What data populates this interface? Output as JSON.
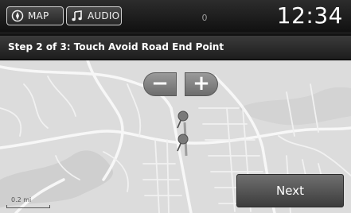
{
  "status_bar": {
    "map_tab": {
      "label": "MAP",
      "icon": "compass-icon"
    },
    "audio_tab": {
      "label": "AUDIO",
      "icon": "music-note-icon"
    },
    "signal_indicator": "0",
    "clock": "12:34"
  },
  "banner": {
    "instruction": "Step 2 of 3: Touch Avoid Road End Point"
  },
  "map": {
    "zoom_out_label": "−",
    "zoom_in_label": "+",
    "pins": [
      {
        "icon": "map-pin-icon",
        "color": "#6e6e6e"
      },
      {
        "icon": "map-pin-icon",
        "color": "#6e6e6e"
      }
    ],
    "scale_label": "0.2 mi"
  },
  "actions": {
    "next_label": "Next"
  },
  "colors": {
    "map_background": "#dcdcdc",
    "road": "#f7f7f7",
    "water": "#bdbdbd",
    "button": "#5a5a5a"
  }
}
